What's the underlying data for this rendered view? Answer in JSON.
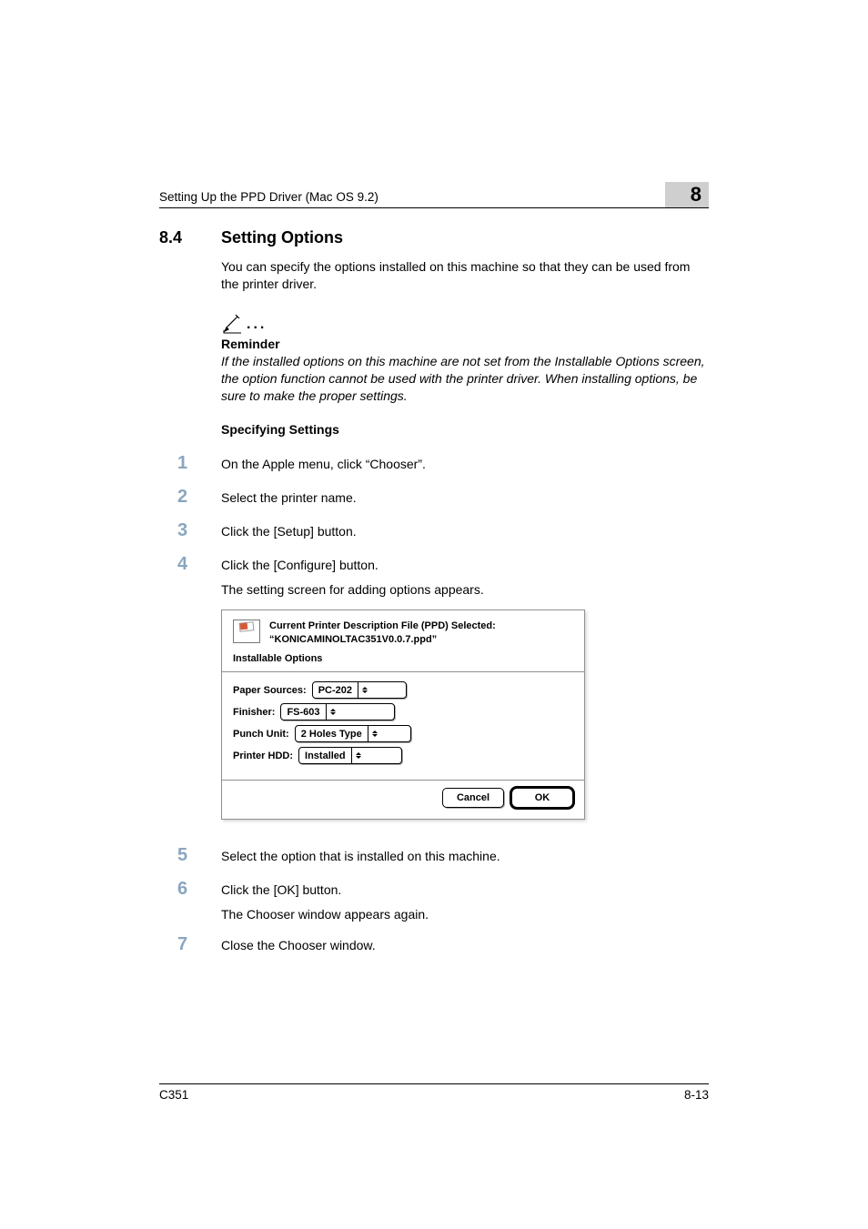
{
  "header": {
    "running_title": "Setting Up the PPD Driver (Mac OS 9.2)",
    "chapter_number": "8"
  },
  "section": {
    "number": "8.4",
    "title": "Setting Options",
    "intro": "You can specify the options installed on this machine so that they can be used from the printer driver."
  },
  "reminder": {
    "label": "Reminder",
    "body": "If the installed options on this machine are not set from the Installable Options screen, the option function cannot be used with the printer driver. When installing options, be sure to make the proper settings."
  },
  "subheading": "Specifying Settings",
  "steps": {
    "s1": {
      "n": "1",
      "text": "On the Apple menu, click “Chooser”."
    },
    "s2": {
      "n": "2",
      "text": "Select the printer name."
    },
    "s3": {
      "n": "3",
      "text": "Click the [Setup] button."
    },
    "s4": {
      "n": "4",
      "text": "Click the [Configure] button.",
      "follow": "The setting screen for adding options appears."
    },
    "s5": {
      "n": "5",
      "text": "Select the option that is installed on this machine."
    },
    "s6": {
      "n": "6",
      "text": "Click the [OK] button.",
      "follow": "The Chooser window appears again."
    },
    "s7": {
      "n": "7",
      "text": "Close the Chooser window."
    }
  },
  "dialog": {
    "title_line1": "Current Printer Description File (PPD) Selected:",
    "title_line2": "“KONICAMINOLTAC351V0.0.7.ppd”",
    "section_label": "Installable Options",
    "options": {
      "paper_sources": {
        "label": "Paper Sources:",
        "value": "PC-202"
      },
      "finisher": {
        "label": "Finisher:",
        "value": "FS-603"
      },
      "punch_unit": {
        "label": "Punch Unit:",
        "value": "2 Holes Type"
      },
      "printer_hdd": {
        "label": "Printer HDD:",
        "value": "Installed"
      }
    },
    "buttons": {
      "cancel": "Cancel",
      "ok": "OK"
    }
  },
  "footer": {
    "model": "C351",
    "page": "8-13"
  }
}
